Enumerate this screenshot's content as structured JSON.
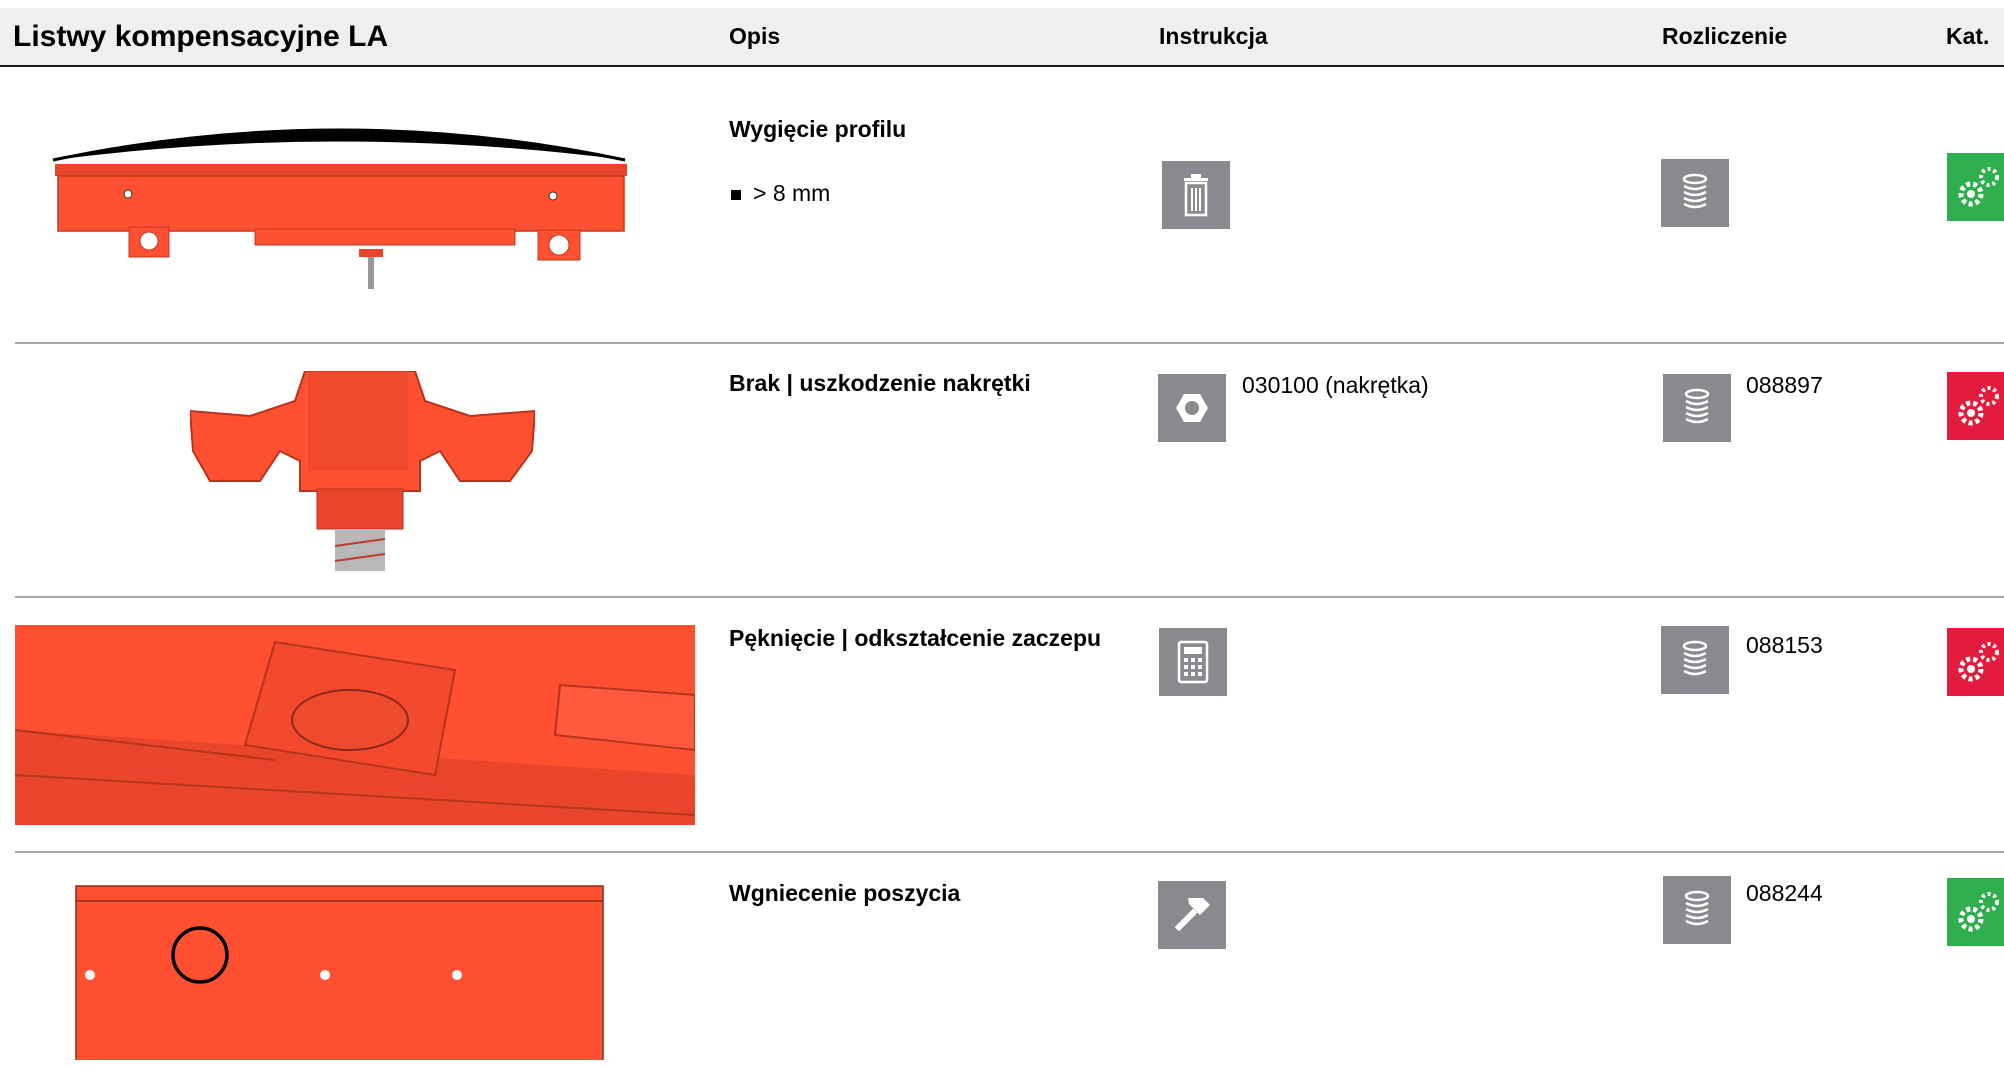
{
  "header": {
    "title": "Listwy kompensacyjne LA",
    "col_opis": "Opis",
    "col_instrukcja": "Instrukcja",
    "col_rozliczenie": "Rozliczenie",
    "col_kat": "Kat."
  },
  "colors": {
    "part": "#ff5032",
    "icon_bg": "#888a8d",
    "kat_green": "#2fae4e",
    "kat_red": "#e31b3c"
  },
  "rows": [
    {
      "desc": "Wygięcie profilu",
      "bullet": "> 8 mm",
      "instr_icon": "trash-icon",
      "instr_code": "",
      "roz_icon": "coin-stack-icon",
      "roz_code": "",
      "kat": "green"
    },
    {
      "desc": "Brak | uszkodzenie nakrętki",
      "bullet": "",
      "instr_icon": "nut-icon",
      "instr_code": "030100 (nakrętka)",
      "roz_icon": "coin-stack-icon",
      "roz_code": "088897",
      "kat": "red"
    },
    {
      "desc": "Pęknięcie | odkształcenie zaczepu",
      "bullet": "",
      "instr_icon": "calculator-icon",
      "instr_code": "",
      "roz_icon": "coin-stack-icon",
      "roz_code": "088153",
      "kat": "red"
    },
    {
      "desc": "Wgniecenie poszycia",
      "bullet": "",
      "instr_icon": "hammer-icon",
      "instr_code": "",
      "roz_icon": "coin-stack-icon",
      "roz_code": "088244",
      "kat": "green"
    }
  ]
}
